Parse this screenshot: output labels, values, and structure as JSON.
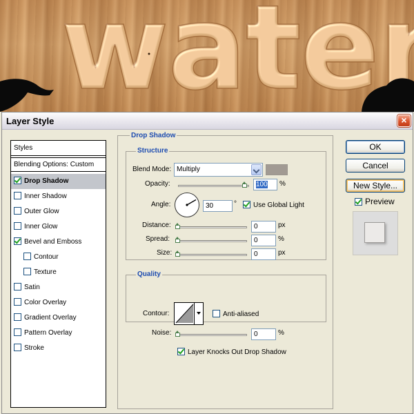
{
  "background": {
    "text": "water"
  },
  "dialog": {
    "title": "Layer Style",
    "close_label": "×"
  },
  "styles_list": {
    "header": "Styles",
    "blending_options": "Blending Options: Custom",
    "items": [
      {
        "label": "Drop Shadow",
        "checked": true,
        "selected": true
      },
      {
        "label": "Inner Shadow",
        "checked": false
      },
      {
        "label": "Outer Glow",
        "checked": false
      },
      {
        "label": "Inner Glow",
        "checked": false
      },
      {
        "label": "Bevel and Emboss",
        "checked": true
      },
      {
        "label": "Contour",
        "checked": false
      },
      {
        "label": "Texture",
        "checked": false
      },
      {
        "label": "Satin",
        "checked": false
      },
      {
        "label": "Color Overlay",
        "checked": false
      },
      {
        "label": "Gradient Overlay",
        "checked": false
      },
      {
        "label": "Pattern Overlay",
        "checked": false
      },
      {
        "label": "Stroke",
        "checked": false
      }
    ]
  },
  "drop_shadow": {
    "title": "Drop Shadow",
    "structure": {
      "title": "Structure",
      "blend_mode_label": "Blend Mode:",
      "blend_mode_value": "Multiply",
      "shadow_color": "#a19a93",
      "opacity_label": "Opacity:",
      "opacity_value": "100",
      "opacity_unit": "%",
      "angle_label": "Angle:",
      "angle_value": "30",
      "angle_unit": "°",
      "use_global_light_label": "Use Global Light",
      "use_global_light": true,
      "distance_label": "Distance:",
      "distance_value": "0",
      "distance_unit": "px",
      "spread_label": "Spread:",
      "spread_value": "0",
      "spread_unit": "%",
      "size_label": "Size:",
      "size_value": "0",
      "size_unit": "px"
    },
    "quality": {
      "title": "Quality",
      "contour_label": "Contour:",
      "anti_aliased_label": "Anti-aliased",
      "anti_aliased": false,
      "noise_label": "Noise:",
      "noise_value": "0",
      "noise_unit": "%"
    },
    "layer_knocks_out_label": "Layer Knocks Out Drop Shadow",
    "layer_knocks_out": true
  },
  "buttons": {
    "ok": "OK",
    "cancel": "Cancel",
    "new_style": "New Style...",
    "preview_label": "Preview",
    "preview": true
  },
  "colors": {
    "heading_blue": "#1c4bb0",
    "selected_row": "#c3c6cc",
    "dialog_bg": "#ece9d8"
  }
}
